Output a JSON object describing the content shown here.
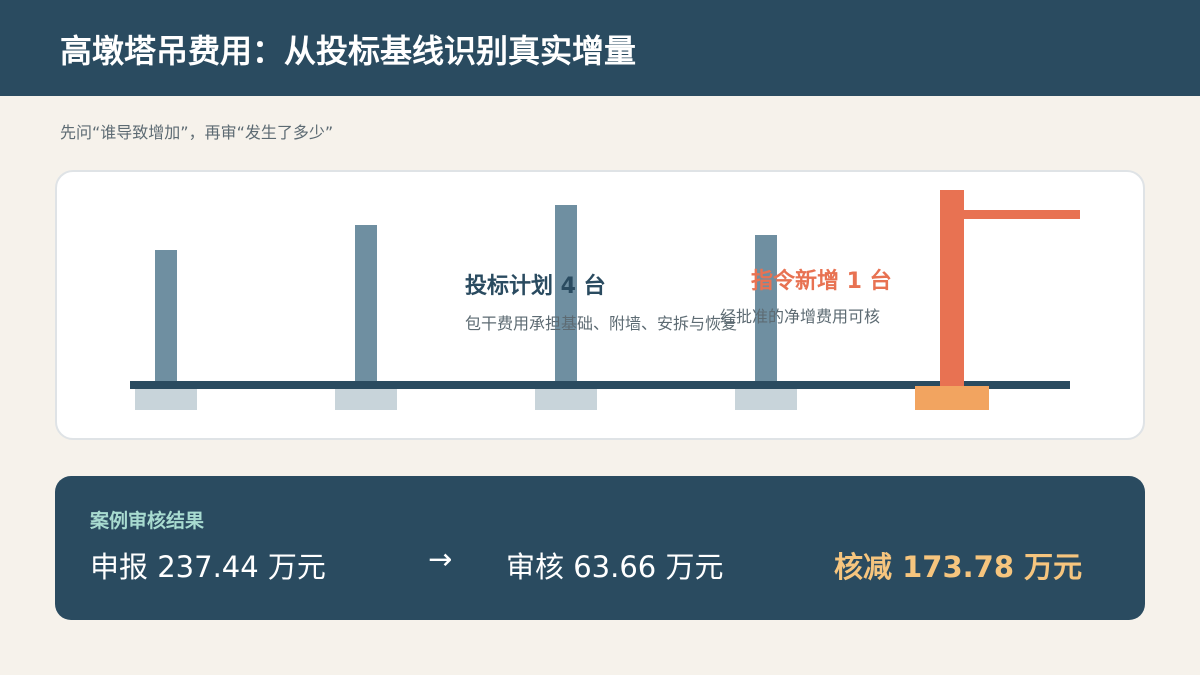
{
  "header": {
    "title": "高墩塔吊费用：从投标基线识别真实增量"
  },
  "subtitle": "先问“谁导致增加”，再审“发生了多少”",
  "diagram": {
    "bid_plan": {
      "label": "投标计划 4 台",
      "description": "包干费用承担基础、附墙、安拆与恢复",
      "count": 4
    },
    "instructed_new": {
      "label": "指令新增 1 台",
      "description": "经批准的净增费用可核",
      "count": 1
    },
    "colors": {
      "plan_mast": "#6f8fa1",
      "plan_base": "#c8d4da",
      "new_crane": "#e87252",
      "new_base": "#f2a460",
      "ground": "#2a4b60"
    }
  },
  "result": {
    "heading": "案例审核结果",
    "declared": "申报 237.44 万元",
    "arrow": "→",
    "audited": "审核 63.66 万元",
    "reduction": "核减 173.78 万元"
  }
}
